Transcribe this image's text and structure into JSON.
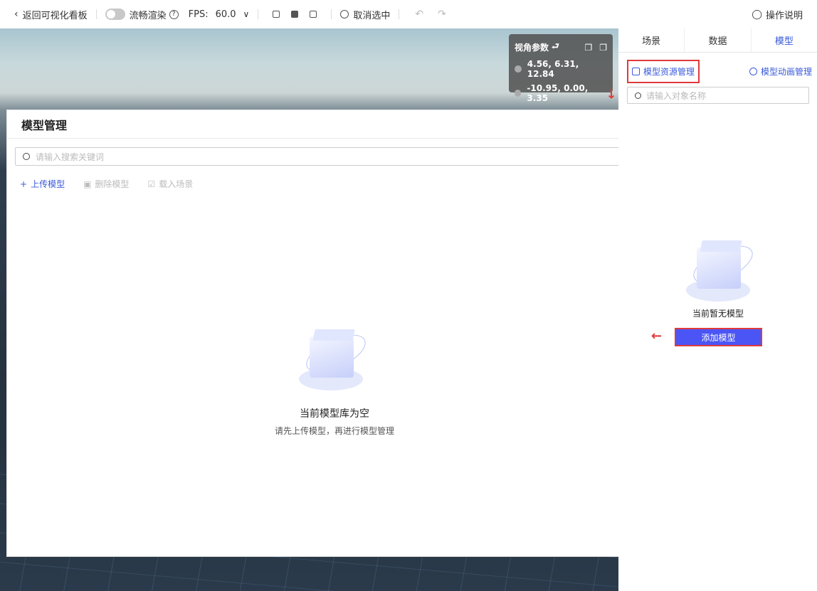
{
  "topbar": {
    "back_label": "返回可视化看板",
    "smooth_label": "流畅渲染",
    "fps_label": "FPS:",
    "fps_value": "60.0",
    "deselect_label": "取消选中",
    "help_label": "操作说明"
  },
  "view_params": {
    "title": "视角参数",
    "camera": "4.56, 6.31, 12.84",
    "target": "-10.95, 0.00, 3.35"
  },
  "modal": {
    "title": "模型管理",
    "search_placeholder": "请输入搜索关键词",
    "upload_label": "上传模型",
    "delete_label": "删除模型",
    "load_label": "载入场景",
    "empty_title": "当前模型库为空",
    "empty_subtitle": "请先上传模型，再进行模型管理"
  },
  "sidepanel": {
    "tabs": [
      {
        "label": "场景"
      },
      {
        "label": "数据"
      },
      {
        "label": "模型"
      }
    ],
    "resource_link": "模型资源管理",
    "animation_link": "模型动画管理",
    "search_placeholder": "请输入对象名称",
    "empty_title": "当前暂无模型",
    "add_button": "添加模型"
  },
  "colors": {
    "accent": "#3a5ad9",
    "primary_button": "#4b55f5",
    "highlight": "#e03a3a"
  }
}
